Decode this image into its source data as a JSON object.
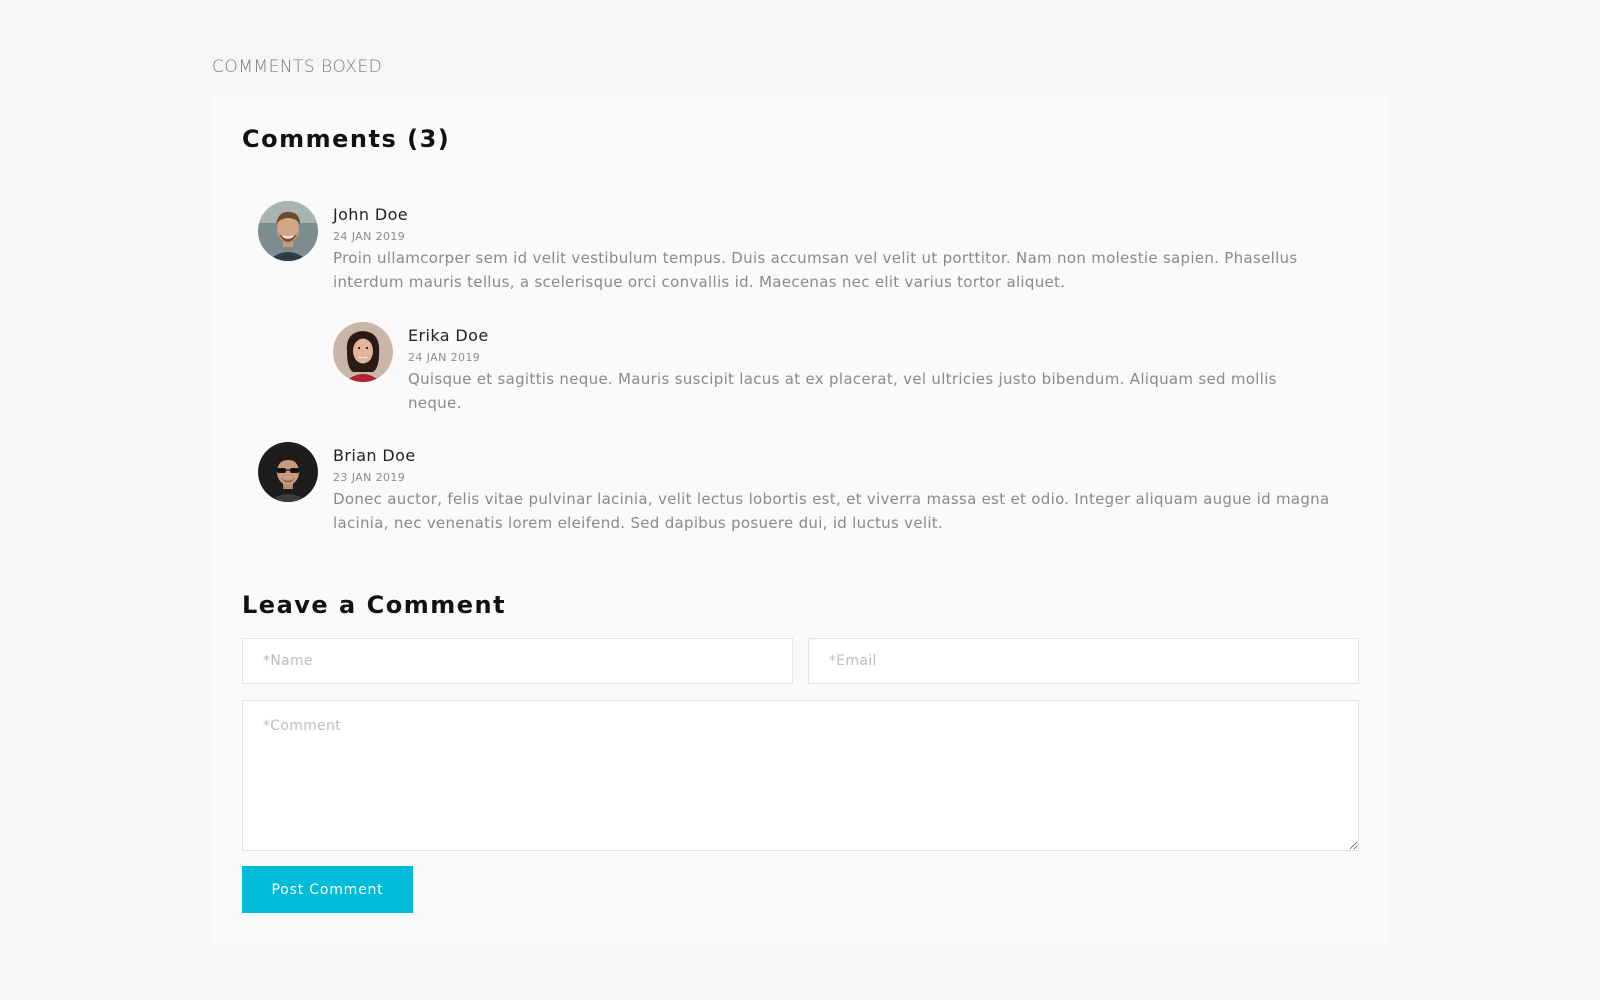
{
  "section": {
    "label": "COMMENTS BOXED"
  },
  "comments_section": {
    "title": "Comments (3)",
    "items": [
      {
        "author": "John Doe",
        "date": "24 JAN 2019",
        "text": "Proin ullamcorper sem id velit vestibulum tempus. Duis accumsan vel velit ut porttitor. Nam non molestie sapien. Phasellus interdum mauris tellus, a scelerisque orci convallis id. Maecenas nec elit varius tortor aliquet.",
        "avatar": "avatar-photo"
      },
      {
        "author": "Erika Doe",
        "date": "24 JAN 2019",
        "text": "Quisque et sagittis neque. Mauris suscipit lacus at ex placerat, vel ultricies justo bibendum. Aliquam sed mollis neque.",
        "avatar": "avatar-photo",
        "is_reply": true
      },
      {
        "author": "Brian Doe",
        "date": "23 JAN 2019",
        "text": "Donec auctor, felis vitae pulvinar lacinia, velit lectus lobortis est, et viverra massa est et odio. Integer aliquam augue id magna lacinia, nec venenatis lorem eleifend. Sed dapibus posuere dui, id luctus velit.",
        "avatar": "avatar-photo"
      }
    ]
  },
  "form": {
    "title": "Leave a Comment",
    "name_placeholder": "*Name",
    "email_placeholder": "*Email",
    "comment_placeholder": "*Comment",
    "submit_label": "Post Comment"
  },
  "colors": {
    "accent": "#00bcd9",
    "page_background": "#f6f6f6",
    "card_background": "#fafafa"
  }
}
